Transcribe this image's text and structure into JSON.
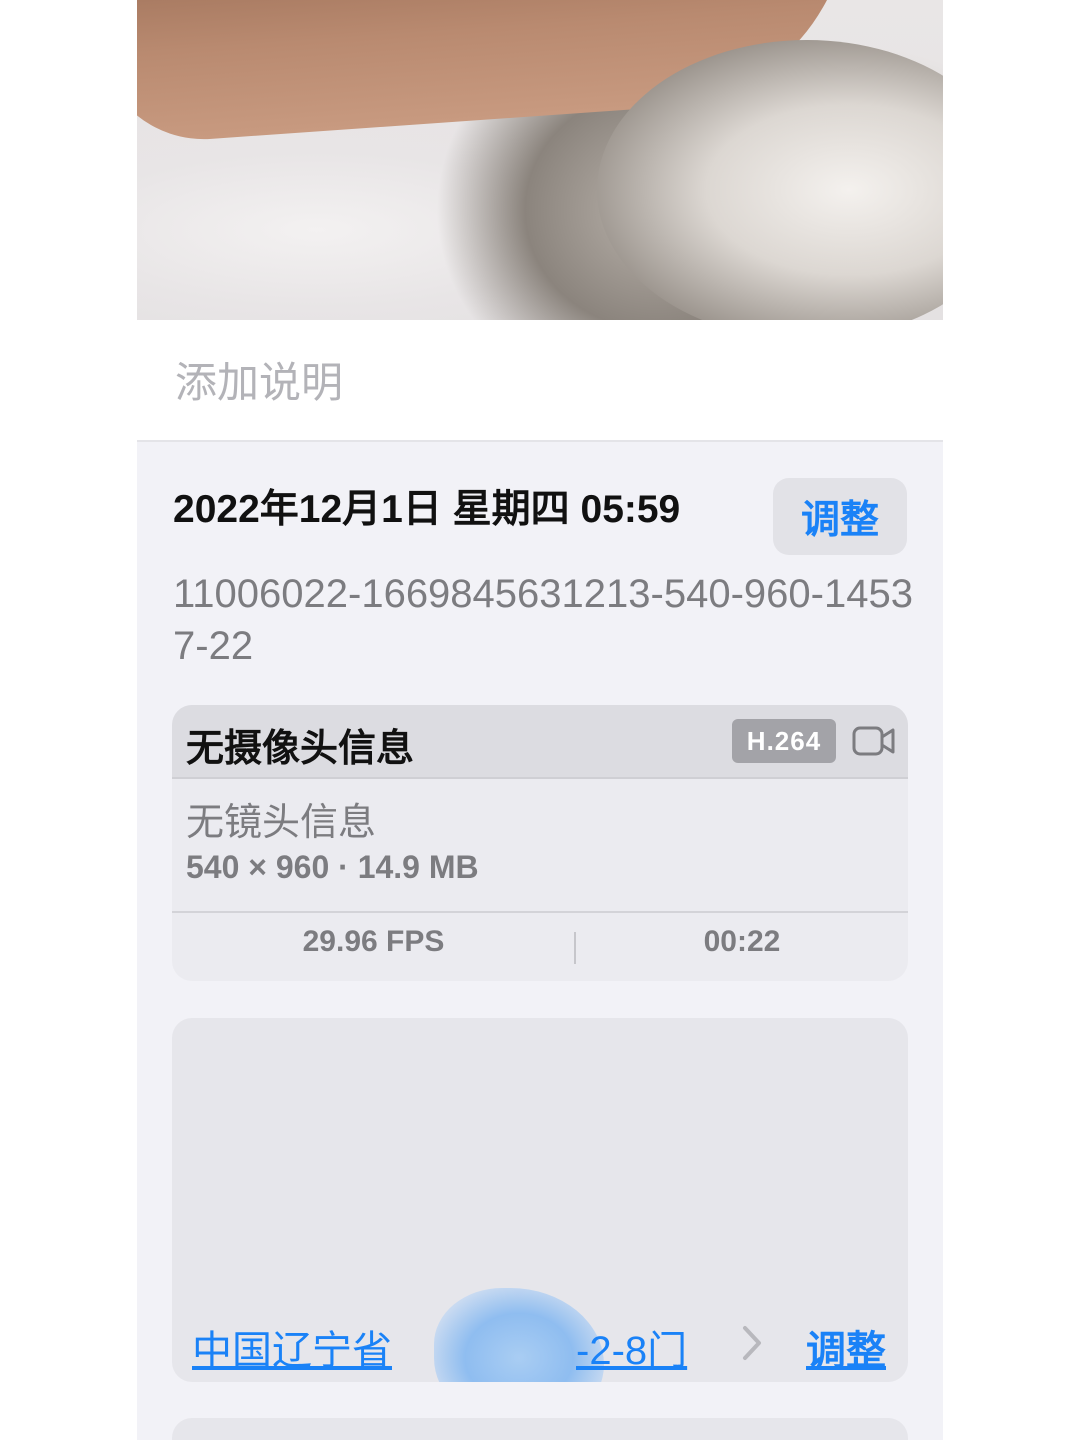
{
  "caption": {
    "placeholder": "添加说明"
  },
  "info": {
    "date_time": "2022年12月1日 星期四 05:59",
    "adjust_label": "调整",
    "filename": "11006022-1669845631213-540-960-14537-22"
  },
  "media": {
    "camera": "无摄像头信息",
    "codec": "H.264",
    "lens": "无镜头信息",
    "dimensions": "540 × 960 · 14.9 MB",
    "fps": "29.96 FPS",
    "duration": "00:22",
    "icon": "video-camera-icon"
  },
  "location": {
    "address_start": "中国辽宁省",
    "address_end": "-2-8门",
    "adjust_label": "调整",
    "chevron": "chevron-right-icon"
  },
  "colors": {
    "accent": "#1a82f7",
    "background": "#f2f2f7",
    "secondary_text": "#7c7c80"
  }
}
